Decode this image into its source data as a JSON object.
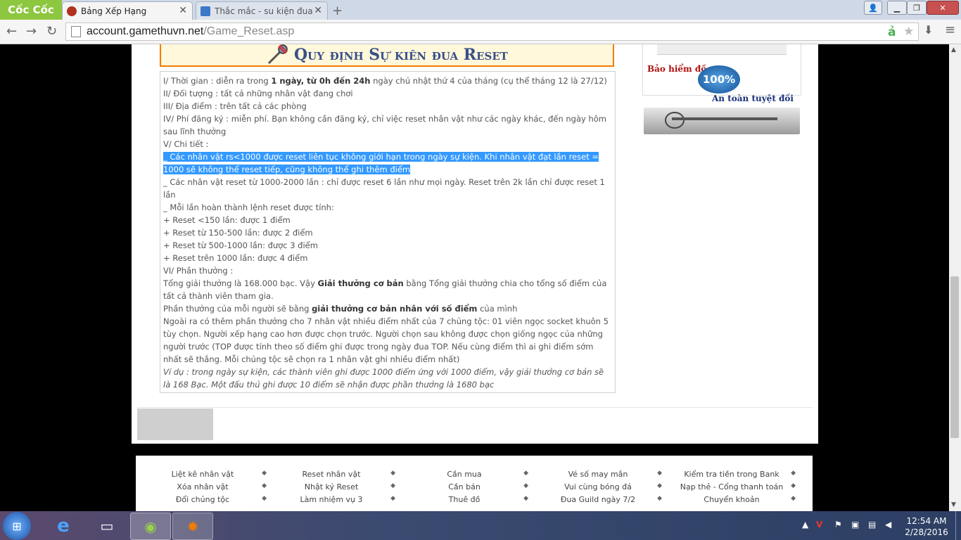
{
  "browser": {
    "brand": "Cốc Cốc",
    "tabs": [
      {
        "title": "Bảng Xếp Hạng",
        "active": true
      },
      {
        "title": "Thắc mắc - su kiện đua re",
        "active": false
      }
    ],
    "new_tab": "+",
    "url_domain": "account.gamethuvn.net",
    "url_path": "/Game_Reset.asp",
    "window_controls": {
      "user": "👤",
      "minimize": "▁",
      "maximize": "❐",
      "close": "✕"
    }
  },
  "page": {
    "heading": "Quy định Sự kiên đua Reset",
    "lines": [
      {
        "pre": "I/ Thời gian : diễn ra trong ",
        "bold": "1 ngày, từ 0h đến 24h",
        "post": " ngày chủ nhật thứ 4 của tháng (cụ thể tháng 12 là 27/12)"
      },
      {
        "pre": "II/ Đối tượng : tất cả những nhân vật đang chơi"
      },
      {
        "pre": "III/ Địa điểm : trên tất cả các phòng"
      },
      {
        "pre": "IV/ Phí đăng ký : miễn phí. Bạn không cần đăng ký, chỉ việc reset nhân vật như các ngày khác, đến ngày hôm sau lĩnh thưởng"
      },
      {
        "pre": "V/ Chi tiết :"
      },
      {
        "selected": "_ Các nhân vật rs<1000 được reset liên tục không giới hạn trong ngày sự kiện. Khi nhân vật đạt lần reset = 1000 sẽ không thể reset tiếp, cũng không thể ghi thêm điểm"
      },
      {
        "pre": "_ Các nhân vật reset từ 1000-2000 lần : chỉ được reset 6 lần như mọi ngày. Reset trên 2k lần chỉ được reset 1 lần"
      },
      {
        "pre": "_ Mỗi lần hoàn thành lệnh reset được tính:"
      },
      {
        "pre": "+ Reset <150 lần: được 1 điểm"
      },
      {
        "pre": "+ Reset từ 150-500 lần: được 2 điểm"
      },
      {
        "pre": "+ Reset từ 500-1000 lần: được 3 điểm"
      },
      {
        "pre": "+ Reset trên 1000 lần: được 4 điểm"
      },
      {
        "pre": "VI/ Phần thưởng :"
      },
      {
        "pre": "Tổng giải thưởng là 168.000 bạc. Vậy ",
        "bold": "Giải thưởng cơ bản",
        "post": " bằng Tổng giải thưởng chia cho tổng số điểm của tất cả thành viên tham gia."
      },
      {
        "pre": "Phần thưởng của mỗi người sẽ bằng ",
        "bold": "giải thưởng cơ bản nhân với số điểm",
        "post": " của mình"
      },
      {
        "pre": "Ngoài ra có thêm phần thưởng cho 7 nhân vật nhiều điểm nhất của 7 chủng tộc: 01 viên ngọc socket khuôn 5 tùy chọn. Người xếp hạng cao hơn được chọn trước. Người chọn sau không được chọn giống ngọc của những người trước (TOP được tính theo số điểm ghi được trong ngày đua TOP. Nếu cùng điểm thì ai ghi điểm sớm nhất sẽ thắng. Mỗi chủng tộc sẽ chọn ra 1 nhân vật ghi nhiều điểm nhất)"
      },
      {
        "italic": "Ví dụ : trong ngày sự kiện, các thành viên ghi được 1000 điểm ứng với 1000 điểm, vậy giải thưởng cơ bản sẽ là 168 Bạc. Một đấu thủ ghi được 10 điểm sẽ nhận được phần thưởng là 1680 bạc"
      }
    ],
    "insurance_top": "Bảo hiểm đồ",
    "insurance_seal": "100%",
    "insurance_bottom": "An toàn tuyệt đối"
  },
  "footer_links": [
    [
      "Liệt kê nhân vật",
      "Reset nhân vật",
      "Cần mua",
      "Vé số may mắn",
      "Kiểm tra tiền trong Bank"
    ],
    [
      "Xóa nhân vật",
      "Nhật ký Reset",
      "Cần bán",
      "Vui cùng bóng đá",
      "Nạp thẻ - Cổng thanh toán"
    ],
    [
      "Đổi chủng tộc",
      "Làm nhiệm vụ 3",
      "Thuê đồ",
      "Đua Guild ngày 7/2",
      "Chuyển khoản"
    ]
  ],
  "taskbar": {
    "time": "12:54 AM",
    "date": "2/28/2016"
  },
  "colors": {
    "selection": "#3399ff",
    "heading_border": "#f07d00",
    "heading_text": "#3a4f8a"
  }
}
